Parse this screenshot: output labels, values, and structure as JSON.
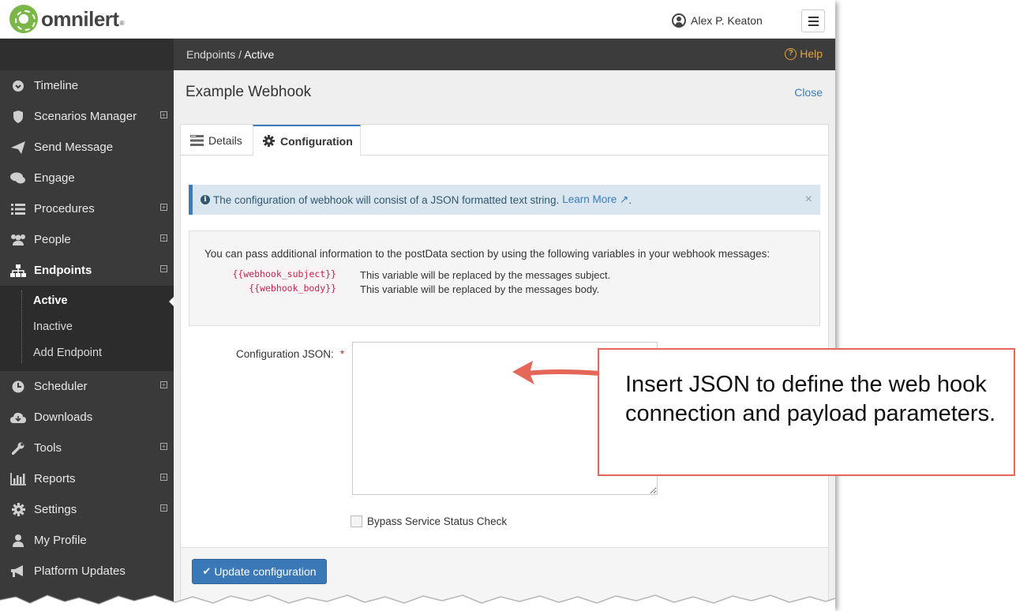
{
  "brand": {
    "name": "omnilert",
    "reg": "®"
  },
  "header": {
    "user_name": "Alex P. Keaton"
  },
  "breadcrumb": {
    "parent": "Endpoints",
    "separator": "/",
    "current": "Active"
  },
  "help_label": "Help",
  "sidebar": {
    "items": [
      {
        "label": "Timeline",
        "icon": "timeline-icon",
        "expandable": false
      },
      {
        "label": "Scenarios Manager",
        "icon": "shield-icon",
        "expandable": true
      },
      {
        "label": "Send Message",
        "icon": "paper-plane-icon",
        "expandable": false
      },
      {
        "label": "Engage",
        "icon": "chat-bubbles-icon",
        "expandable": false
      },
      {
        "label": "Procedures",
        "icon": "list-icon",
        "expandable": true
      },
      {
        "label": "People",
        "icon": "users-icon",
        "expandable": true
      },
      {
        "label": "Endpoints",
        "icon": "sitemap-icon",
        "expandable": true,
        "expanded": true
      },
      {
        "label": "Scheduler",
        "icon": "clock-icon",
        "expandable": true
      },
      {
        "label": "Downloads",
        "icon": "cloud-download-icon",
        "expandable": false
      },
      {
        "label": "Tools",
        "icon": "wrench-icon",
        "expandable": true
      },
      {
        "label": "Reports",
        "icon": "bar-chart-icon",
        "expandable": true
      },
      {
        "label": "Settings",
        "icon": "gear-icon",
        "expandable": true
      },
      {
        "label": "My Profile",
        "icon": "user-icon",
        "expandable": false
      },
      {
        "label": "Platform Updates",
        "icon": "bullhorn-icon",
        "expandable": false
      }
    ],
    "endpoints_sub": [
      "Active",
      "Inactive",
      "Add Endpoint"
    ]
  },
  "page": {
    "title": "Example Webhook",
    "close_label": "Close"
  },
  "tabs": [
    {
      "label": "Details",
      "icon": "details-icon"
    },
    {
      "label": "Configuration",
      "icon": "gear-icon",
      "active": true
    }
  ],
  "alert": {
    "text": "The configuration of webhook will consist of a JSON formatted text string.",
    "link": "Learn More",
    "suffix": "."
  },
  "variables": {
    "intro": "You can pass additional information to the postData section by using the following variables in your webhook messages:",
    "rows": [
      {
        "code": "{{webhook_subject}}",
        "desc": "This variable will be replaced by the messages subject."
      },
      {
        "code": "{{webhook_body}}",
        "desc": "This variable will be replaced by the messages body."
      }
    ]
  },
  "form": {
    "json_label": "Configuration JSON:",
    "required_mark": "*",
    "json_value": "",
    "bypass_label": "Bypass Service Status Check",
    "bypass_checked": false,
    "submit_label": "Update configuration"
  },
  "callout": {
    "text": "Insert JSON to define the web hook connection and payload parameters."
  },
  "colors": {
    "accent": "#3a78b7",
    "sidebar": "#3a3a3a",
    "callout_border": "#e5675a",
    "help": "#e2a53a"
  }
}
